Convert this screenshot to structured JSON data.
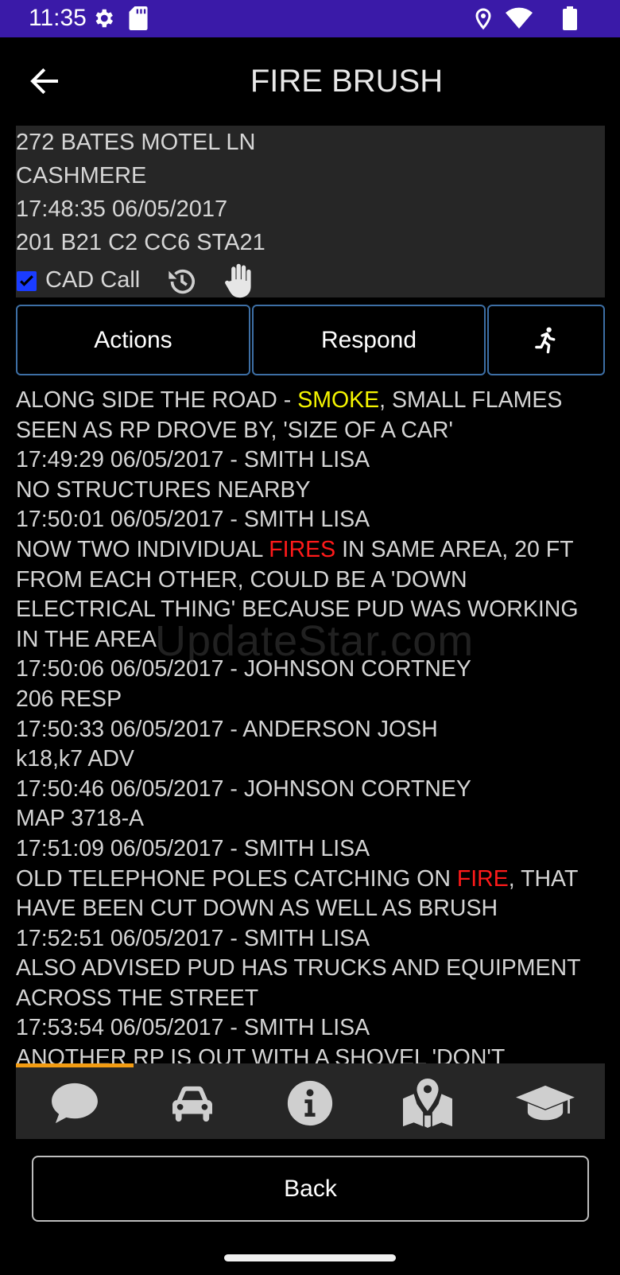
{
  "status_bar": {
    "time": "11:35"
  },
  "header": {
    "title": "FIRE BRUSH"
  },
  "incident": {
    "lines": [
      "272 BATES MOTEL LN",
      "CASHMERE",
      "17:48:35 06/05/2017",
      "201 B21 C2 CC6 STA21"
    ],
    "cad_call_label": "CAD Call"
  },
  "buttons": {
    "actions_label": "Actions",
    "respond_label": "Respond",
    "back_label": "Back"
  },
  "narrative": [
    [
      "ALONG SIDE THE ROAD - ",
      {
        "t": "SMOKE",
        "c": "yellow"
      },
      ", SMALL FLAMES"
    ],
    [
      "SEEN AS RP DROVE BY, 'SIZE OF A CAR'"
    ],
    [
      "17:49:29 06/05/2017 - SMITH LISA"
    ],
    [
      "NO STRUCTURES NEARBY"
    ],
    [
      "17:50:01 06/05/2017 - SMITH LISA"
    ],
    [
      "NOW TWO INDIVIDUAL ",
      {
        "t": "FIRES",
        "c": "red"
      },
      " IN SAME AREA, 20 FT"
    ],
    [
      "FROM EACH OTHER, COULD BE A 'DOWN"
    ],
    [
      "ELECTRICAL THING' BECAUSE PUD WAS WORKING"
    ],
    [
      "IN THE AREA"
    ],
    [
      "17:50:06 06/05/2017 - JOHNSON CORTNEY"
    ],
    [
      "206 RESP"
    ],
    [
      "17:50:33 06/05/2017 - ANDERSON JOSH"
    ],
    [
      "k18,k7 ADV"
    ],
    [
      "17:50:46 06/05/2017 - JOHNSON CORTNEY"
    ],
    [
      "MAP 3718-A"
    ],
    [
      "17:51:09 06/05/2017 - SMITH LISA"
    ],
    [
      "OLD TELEPHONE POLES CATCHING ON ",
      {
        "t": "FIRE",
        "c": "red"
      },
      ", THAT"
    ],
    [
      "HAVE BEEN CUT DOWN AS WELL AS BRUSH"
    ],
    [
      "17:52:51 06/05/2017 - SMITH LISA"
    ],
    [
      "ALSO ADVISED PUD HAS TRUCKS AND EQUIPMENT"
    ],
    [
      "ACROSS THE STREET"
    ],
    [
      "17:53:54 06/05/2017 - SMITH LISA"
    ],
    [
      "ANOTHER RP IS OUT WITH A SHOVEL 'DON'T"
    ]
  ],
  "watermark": "UpdateStar.com",
  "tabs": [
    {
      "icon": "chat-icon",
      "selected": true
    },
    {
      "icon": "car-icon",
      "selected": false
    },
    {
      "icon": "info-icon",
      "selected": false
    },
    {
      "icon": "map-pin-icon",
      "selected": false
    },
    {
      "icon": "graduation-cap-icon",
      "selected": false
    }
  ],
  "colors": {
    "status_bar": "#3a1aa8",
    "panel_bg": "#262626",
    "button_border": "#3d6fa5",
    "tab_indicator": "#f39c12",
    "highlight_yellow": "#f5f500",
    "highlight_red": "#ff1a1a"
  }
}
